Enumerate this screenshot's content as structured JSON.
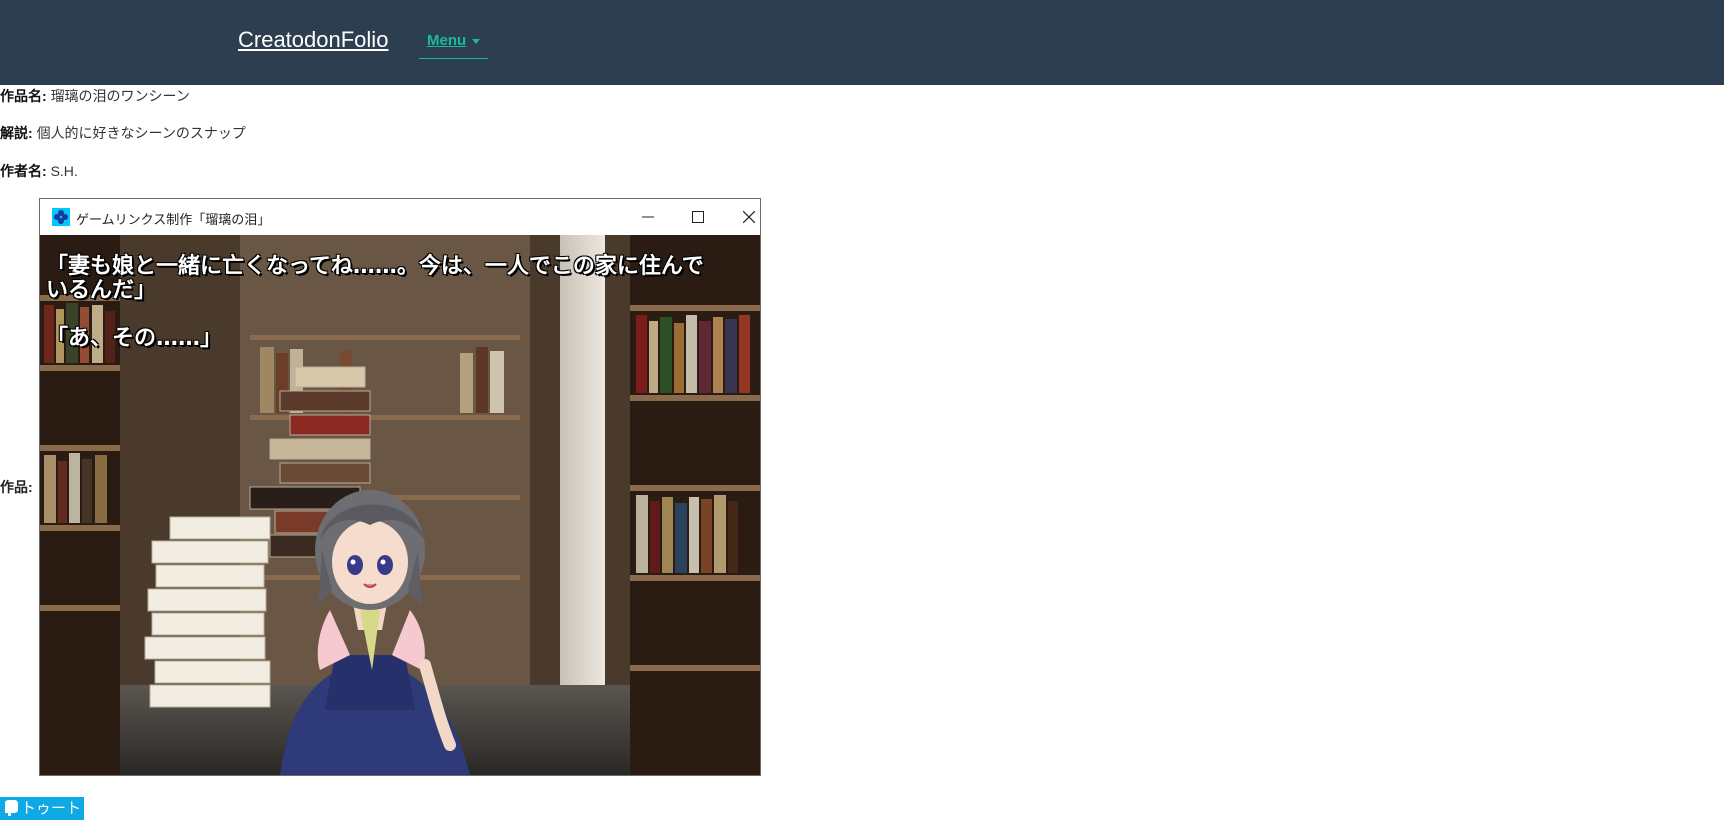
{
  "navbar": {
    "brand": "CreatodonFolio",
    "menu_label": "Menu"
  },
  "info": {
    "title_label": "作品名:",
    "title_value": "瑠璃の泪のワンシーン",
    "desc_label": "解説:",
    "desc_value": "個人的に好きなシーンのスナップ",
    "author_label": "作者名:",
    "author_value": "S.H.",
    "work_label": "作品:"
  },
  "game_window": {
    "title": "ゲームリンクス制作「瑠璃の泪」",
    "lines": [
      "「妻も娘と一緒に亡くなってね……。今は、一人でこの家に住んで",
      "いるんだ」",
      "「あ、その……」"
    ]
  },
  "toot_button": {
    "label": "トゥート"
  },
  "colors": {
    "navbar": "#2c3e50",
    "accent": "#18bc9c",
    "toot": "#0fa9e6"
  }
}
